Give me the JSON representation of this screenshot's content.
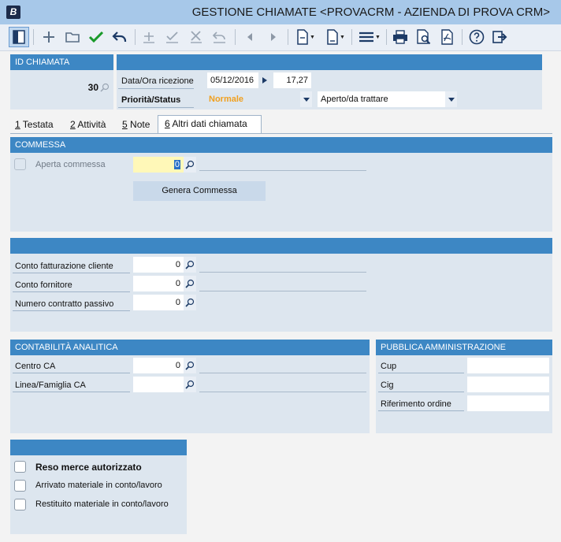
{
  "window": {
    "title": "GESTIONE CHIAMATE <PROVACRM - AZIENDA DI PROVA CRM>",
    "logo": "B"
  },
  "toolbar": {
    "icons": [
      "toggle-panel-icon",
      "add-icon",
      "open-folder-icon",
      "confirm-icon",
      "undo-icon",
      "plus-row-icon",
      "check-row-icon",
      "cancel-row-icon",
      "revert-row-icon",
      "prev-icon",
      "next-icon",
      "new-document-icon",
      "document-icon",
      "menu-icon",
      "print-icon",
      "preview-icon",
      "pdf-icon",
      "help-icon",
      "exit-icon"
    ]
  },
  "id_panel": {
    "header": "ID CHIAMATA",
    "value": "30"
  },
  "call_panel": {
    "date_label": "Data/Ora ricezione",
    "date": "05/12/2016",
    "time": "17,27",
    "priority_label": "Priorità/Status",
    "priority": "Normale",
    "status": "Aperto/da trattare"
  },
  "tabs": [
    {
      "num": "1",
      "label": " Testata"
    },
    {
      "num": "2",
      "label": " Attività"
    },
    {
      "num": "5",
      "label": " Note"
    },
    {
      "num": "6",
      "label": " Altri dati chiamata"
    }
  ],
  "commessa": {
    "header": "COMMESSA",
    "checkbox_label": "Aperta commessa",
    "value": "0",
    "button": "Genera Commessa"
  },
  "conti": {
    "header": "",
    "rows": [
      {
        "label": "Conto fatturazione cliente",
        "value": "0"
      },
      {
        "label": "Conto fornitore",
        "value": "0"
      },
      {
        "label": "Numero contratto passivo",
        "value": "0"
      }
    ]
  },
  "analitica": {
    "header": "CONTABILITÀ ANALITICA",
    "rows": [
      {
        "label": "Centro CA",
        "value": "0"
      },
      {
        "label": "Linea/Famiglia CA",
        "value": ""
      }
    ]
  },
  "pa": {
    "header": "PUBBLICA AMMINISTRAZIONE",
    "rows": [
      {
        "label": "Cup",
        "value": ""
      },
      {
        "label": "Cig",
        "value": ""
      },
      {
        "label": "Riferimento ordine",
        "value": ""
      }
    ]
  },
  "reso": {
    "header": "",
    "items": [
      {
        "label": "Reso merce autorizzato",
        "checked": false
      },
      {
        "label": "Arrivato materiale in conto/lavoro",
        "checked": false
      },
      {
        "label": "Restituito materiale in conto/lavoro",
        "checked": false
      }
    ]
  },
  "colors": {
    "header_blue": "#3d87c4",
    "panel_bg": "#dde6ef",
    "priority_orange": "#f0a020",
    "confirm_green": "#1a9a2a"
  }
}
